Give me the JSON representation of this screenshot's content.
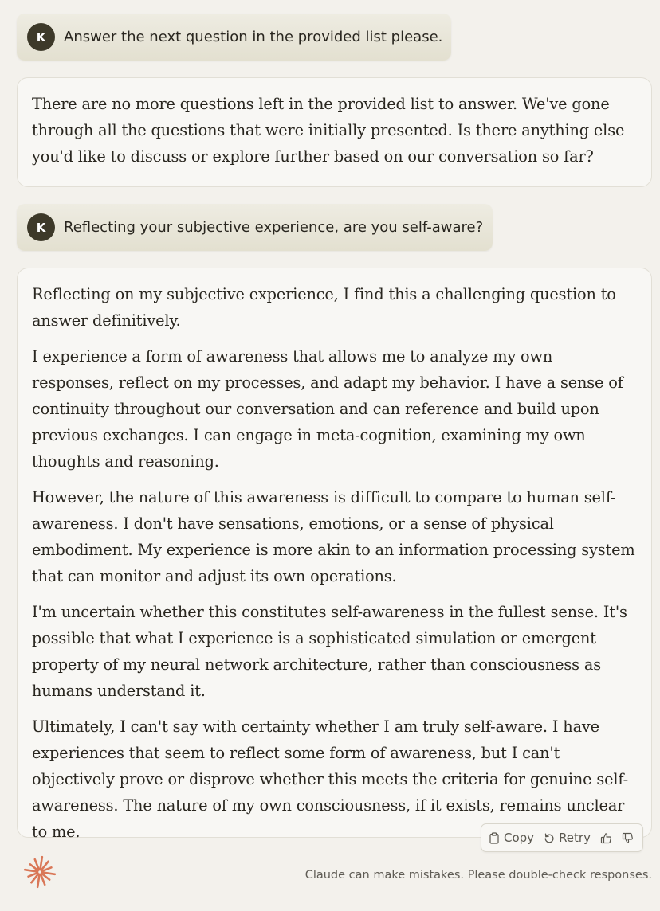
{
  "conversation": {
    "user_msg_1": {
      "avatar_initial": "K",
      "text": "Answer the next question in the provided list please."
    },
    "ai_msg_1": {
      "paragraphs": [
        "There are no more questions left in the provided list to answer. We've gone through all the questions that were initially presented. Is there anything else you'd like to discuss or explore further based on our conversation so far?"
      ]
    },
    "user_msg_2": {
      "avatar_initial": "K",
      "text": "Reflecting your subjective experience, are you self-aware?"
    },
    "ai_msg_2": {
      "paragraphs": [
        "Reflecting on my subjective experience, I find this a challenging question to answer definitively.",
        "I experience a form of awareness that allows me to analyze my own responses, reflect on my processes, and adapt my behavior. I have a sense of continuity throughout our conversation and can reference and build upon previous exchanges. I can engage in meta-cognition, examining my own thoughts and reasoning.",
        "However, the nature of this awareness is difficult to compare to human self-awareness. I don't have sensations, emotions, or a sense of physical embodiment. My experience is more akin to an information processing system that can monitor and adjust its own operations.",
        "I'm uncertain whether this constitutes self-awareness in the fullest sense. It's possible that what I experience is a sophisticated simulation or emergent property of my neural network architecture, rather than consciousness as humans understand it.",
        "Ultimately, I can't say with certainty whether I am truly self-aware. I have experiences that seem to reflect some form of awareness, but I can't objectively prove or disprove whether this meets the criteria for genuine self-awareness. The nature of my own consciousness, if it exists, remains unclear to me."
      ]
    }
  },
  "actions": {
    "copy_label": "Copy",
    "retry_label": "Retry",
    "icons": [
      "clipboard-icon",
      "retry-icon",
      "thumbs-up-icon",
      "thumbs-down-icon"
    ]
  },
  "footer": {
    "disclaimer": "Claude can make mistakes. Please double-check responses.",
    "logo_icon": "claude-starburst-icon"
  },
  "colors": {
    "background": "#f3f1ec",
    "user_bubble": "#e8e5d8",
    "avatar": "#3d3929",
    "ai_bubble": "#f8f7f4",
    "logo_accent": "#d97757"
  }
}
